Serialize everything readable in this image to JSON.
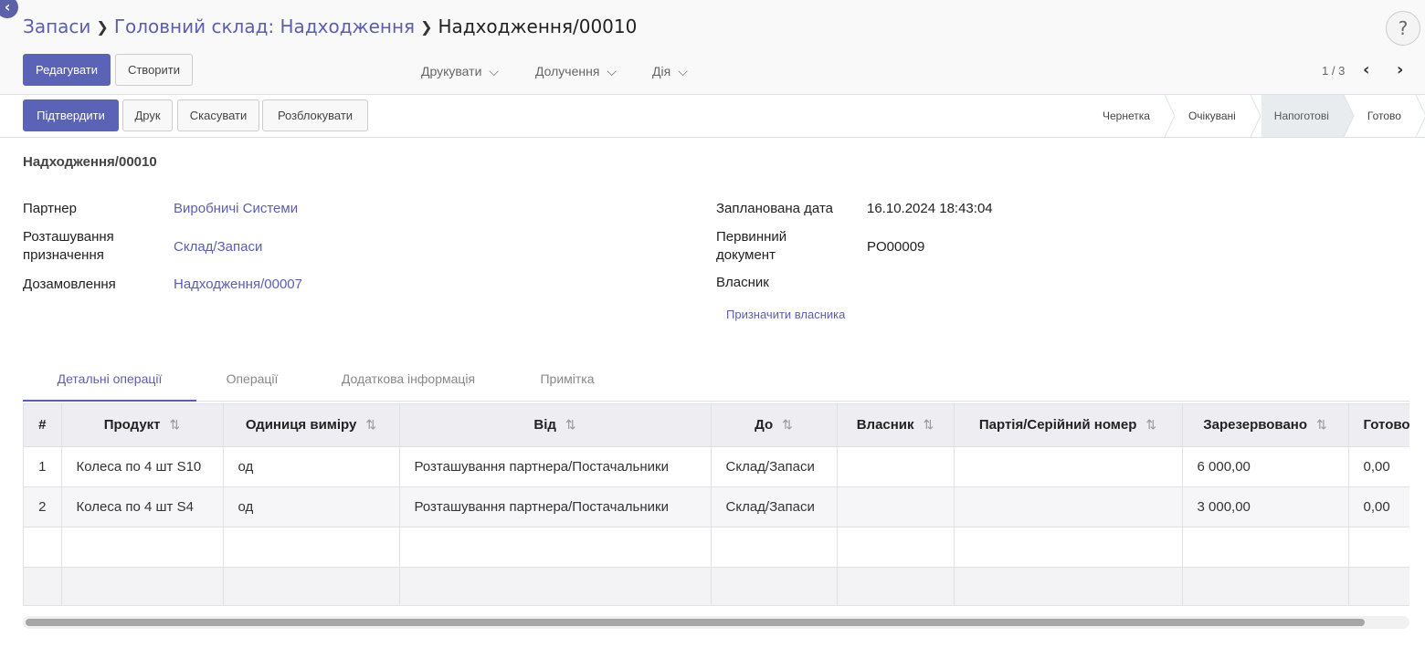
{
  "breadcrumb": {
    "items": [
      "Запаси",
      "Головний склад: Надходження"
    ],
    "current": "Надходження/00010"
  },
  "toolbar": {
    "edit_label": "Редагувати",
    "create_label": "Створити",
    "print_label": "Друкувати",
    "attach_label": "Долучення",
    "action_label": "Дія",
    "pager": "1 / 3"
  },
  "actions": {
    "confirm_label": "Підтвердити",
    "print_label": "Друк",
    "cancel_label": "Скасувати",
    "unlock_label": "Розблокувати"
  },
  "stages": [
    {
      "label": "Чернетка",
      "active": false
    },
    {
      "label": "Очікувані",
      "active": false
    },
    {
      "label": "Напоготові",
      "active": true
    },
    {
      "label": "Готово",
      "active": false
    }
  ],
  "record": {
    "title": "Надходження/00010",
    "partner_label": "Партнер",
    "partner_value": "Виробничі Системи",
    "dest_label": "Розташування призначення",
    "dest_value": "Склад/Запаси",
    "backorder_label": "Дозамовлення",
    "backorder_value": "Надходження/00007",
    "scheduled_label": "Запланована дата",
    "scheduled_value": "16.10.2024 18:43:04",
    "source_label": "Первинний документ",
    "source_value": "PO00009",
    "owner_label": "Власник",
    "assign_owner": "Призначити власника"
  },
  "tabs": [
    "Детальні операції",
    "Операції",
    "Додаткова інформація",
    "Примітка"
  ],
  "table": {
    "columns": [
      "#",
      "Продукт",
      "Одиниця виміру",
      "Від",
      "До",
      "Власник",
      "Партія/Серійний номер",
      "Зарезервовано",
      "Готово"
    ],
    "rows": [
      [
        "1",
        "Колеса по 4 шт S10",
        "од",
        "Розташування партнера/Постачальники",
        "Склад/Запаси",
        "",
        "",
        "6 000,00",
        "0,00"
      ],
      [
        "2",
        "Колеса по 4 шт S4",
        "од",
        "Розташування партнера/Постачальники",
        "Склад/Запаси",
        "",
        "",
        "3 000,00",
        "0,00"
      ]
    ]
  },
  "colors": {
    "accent": "#5b63b7",
    "link": "#5b5fae"
  }
}
